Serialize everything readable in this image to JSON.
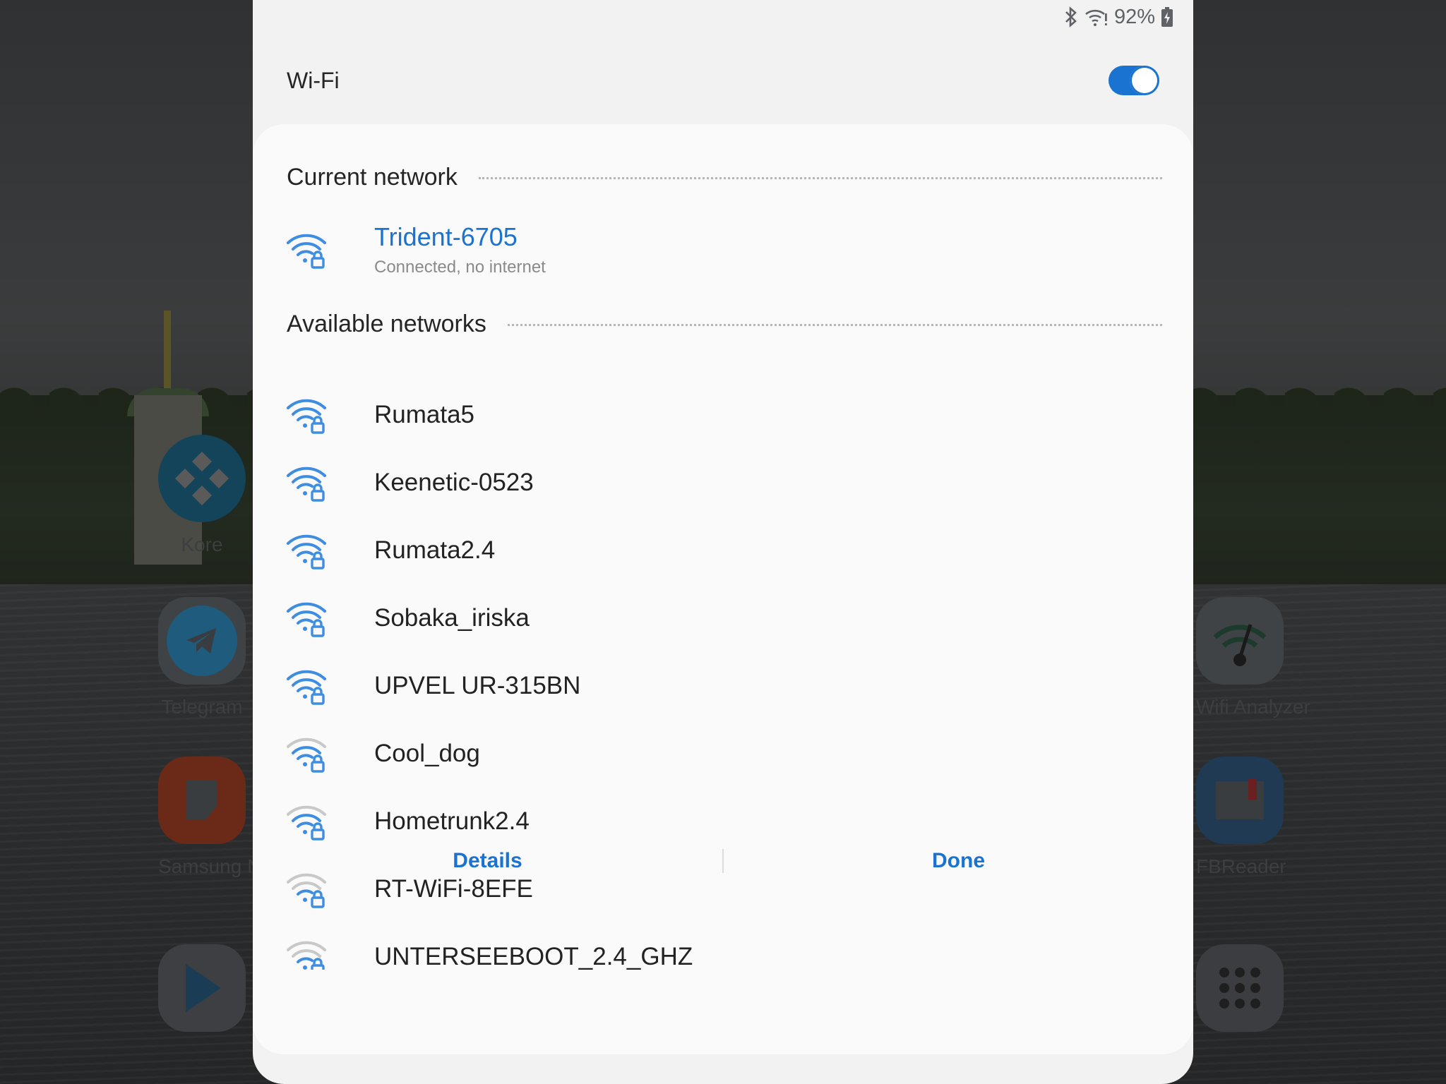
{
  "status_bar": {
    "battery_text": "92%",
    "icons": [
      "bluetooth-icon",
      "wifi-warning-icon",
      "battery-charging-icon"
    ]
  },
  "wifi": {
    "title": "Wi-Fi",
    "enabled": true
  },
  "current_network": {
    "section_title": "Current network",
    "name": "Trident-6705",
    "status": "Connected, no internet"
  },
  "available_networks": {
    "section_title": "Available networks",
    "items": [
      {
        "name": "Rumata5",
        "signal": 4,
        "secured": true
      },
      {
        "name": "Keenetic-0523",
        "signal": 4,
        "secured": true
      },
      {
        "name": "Rumata2.4",
        "signal": 4,
        "secured": true
      },
      {
        "name": "Sobaka_iriska",
        "signal": 4,
        "secured": true
      },
      {
        "name": "UPVEL UR-315BN",
        "signal": 4,
        "secured": true
      },
      {
        "name": "Cool_dog",
        "signal": 3,
        "secured": true
      },
      {
        "name": "Hometrunk2.4",
        "signal": 3,
        "secured": true
      },
      {
        "name": "RT-WiFi-8EFE",
        "signal": 2,
        "secured": true
      },
      {
        "name": "UNTERSEEBOOT_2.4_GHZ",
        "signal": 2,
        "secured": true
      }
    ]
  },
  "footer": {
    "details_label": "Details",
    "done_label": "Done"
  },
  "background_apps": {
    "kore": "Kore",
    "telegram": "Telegram",
    "samsung_notes": "Samsung Not",
    "wifi_analyzer": "Wifi Analyzer",
    "fbreader": "FBReader"
  },
  "colors": {
    "accent": "#1a73d0",
    "wifi_icon": "#3d8de3",
    "wifi_icon_weak": "#c8c8c8"
  }
}
